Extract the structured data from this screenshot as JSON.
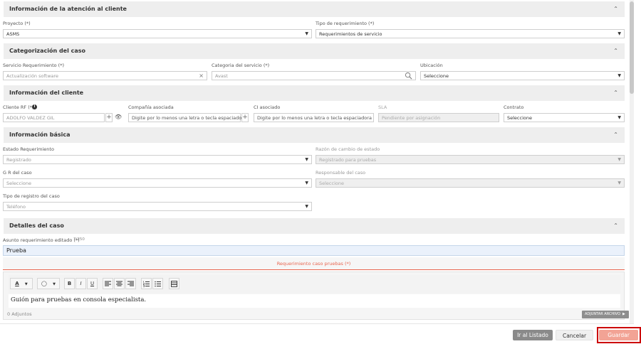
{
  "sections": {
    "atencion": "Información de la atención al cliente",
    "categorizacion": "Categorización del caso",
    "cliente": "Información del cliente",
    "basica": "Información básica",
    "detalles": "Detalles del caso"
  },
  "atencion": {
    "proyecto_label": "Proyecto (*)",
    "proyecto_value": "ASMS",
    "tipo_label": "Tipo de requerimiento (*)",
    "tipo_value": "Requerimientos de servicio"
  },
  "categorizacion": {
    "servicio_label": "Servicio Requerimiento (*)",
    "servicio_value": "Actualización software",
    "categoria_label": "Categoria del servicio (*)",
    "categoria_value": "Avast",
    "ubicacion_label": "Ubicación",
    "ubicacion_value": "Seleccione"
  },
  "cliente": {
    "cliente_label": "Cliente RF (*)",
    "cliente_value": "ADOLFO VALDEZ GIL",
    "compania_label": "Compañía asociada",
    "compania_placeholder": "Digite por lo menos una letra o tecla espaciadora",
    "ci_label": "CI asociado",
    "ci_placeholder": "Digite por lo menos una letra o tecla espaciadora",
    "sla_label": "SLA",
    "sla_placeholder": "Pendiente por asignación",
    "contrato_label": "Contrato",
    "contrato_value": "Seleccione"
  },
  "basica": {
    "estado_label": "Estado Requerimiento",
    "estado_value": "Registrado",
    "razon_label": "Razón de cambio de estado",
    "razon_value": "Registrado para pruebas",
    "gr_label": "G R del caso",
    "gr_value": "Seleccione",
    "responsable_label": "Responsable del caso",
    "responsable_value": "Seleccione",
    "tipo_registro_label": "Tipo de registro del caso",
    "tipo_registro_value": "Teléfono"
  },
  "detalles": {
    "asunto_label": "Asunto requerimiento editado (*)",
    "asunto_count": "7/250",
    "asunto_value": "Prueba",
    "descripcion_label": "Requerimiento caso pruebas (*)",
    "editor_text": "Guión para pruebas en consola especialista.",
    "adjuntos": "0 Adjuntos",
    "adjuntar": "ADJUNTAR ARCHIVO"
  },
  "toolbar": {
    "font_a": "A",
    "bold": "B",
    "italic": "I",
    "underline": "U"
  },
  "actions": {
    "ir_listado": "Ir al Listado",
    "cancelar": "Cancelar",
    "guardar": "Guardar"
  },
  "colors": {
    "accent": "#e8654f",
    "guardar_bg": "#f2a395",
    "highlight_border": "#cc0000",
    "listado_bg": "#8a8a8a",
    "asunto_bg": "#eaf1fb"
  }
}
